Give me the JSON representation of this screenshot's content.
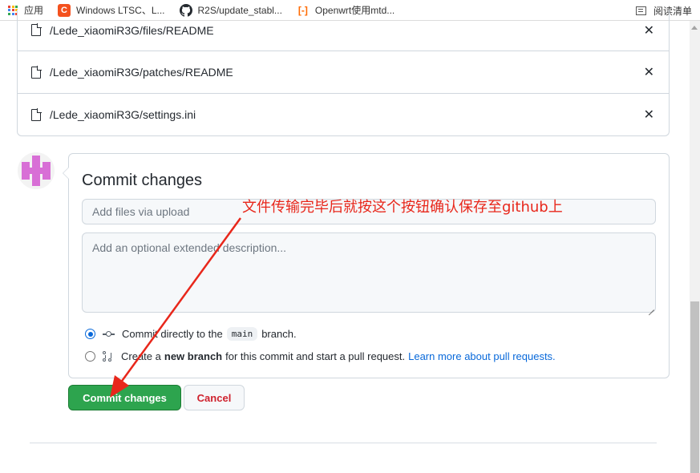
{
  "bookmarks": {
    "apps_label": "应用",
    "items": [
      {
        "label": "Windows LTSC、L...",
        "icon": "c-icon"
      },
      {
        "label": "R2S/update_stabl...",
        "icon": "github-icon"
      },
      {
        "label": "Openwrt使用mtd...",
        "icon": "openwrt-icon"
      }
    ],
    "reading_list": "阅读清单"
  },
  "files": [
    {
      "path": "/Lede_xiaomiR3G/files/README",
      "remove": "✕"
    },
    {
      "path": "/Lede_xiaomiR3G/patches/README",
      "remove": "✕"
    },
    {
      "path": "/Lede_xiaomiR3G/settings.ini",
      "remove": "✕"
    }
  ],
  "commit": {
    "title": "Commit changes",
    "summary_placeholder": "Add files via upload",
    "description_placeholder": "Add an optional extended description...",
    "option_direct": {
      "prefix": "Commit directly to the",
      "branch": "main",
      "suffix": "branch.",
      "selected": true
    },
    "option_new_branch": {
      "prefix": "Create a",
      "bold": "new branch",
      "middle": "for this commit and start a pull request.",
      "link": "Learn more about pull requests.",
      "selected": false
    },
    "commit_button": "Commit changes",
    "cancel_button": "Cancel"
  },
  "annotation": {
    "text": "文件传输完毕后就按这个按钮确认保存至github上",
    "color": "#e8271b"
  },
  "colors": {
    "primary_green": "#2da44e",
    "cancel_red": "#cf222e",
    "link_blue": "#0969da",
    "avatar_pink": "#d86fd6"
  }
}
